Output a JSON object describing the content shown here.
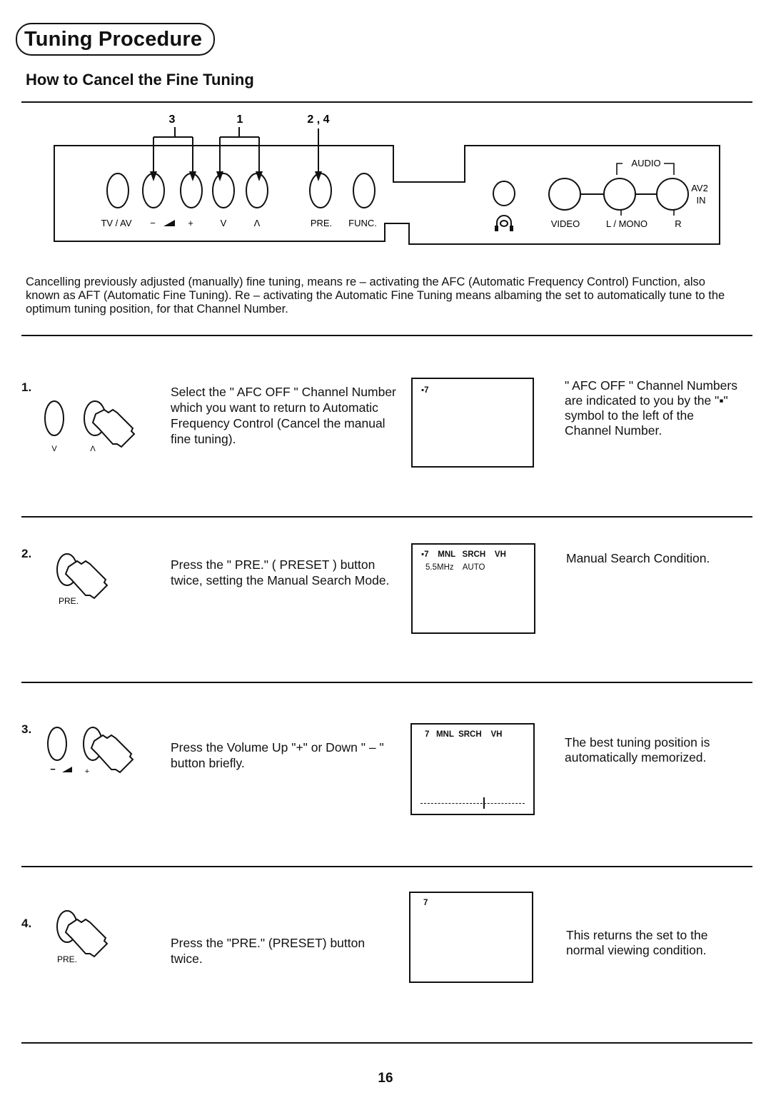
{
  "header": {
    "section_title": "Tuning Procedure",
    "subtitle": "How to Cancel the Fine Tuning"
  },
  "panel": {
    "callouts": [
      {
        "label": "3",
        "targets": [
          "volume-down",
          "volume-up"
        ]
      },
      {
        "label": "1",
        "targets": [
          "channel-down",
          "channel-up"
        ]
      },
      {
        "label": "2 , 4",
        "targets": [
          "preset"
        ]
      }
    ],
    "buttons": [
      {
        "id": "tv-av",
        "label": "TV / AV"
      },
      {
        "id": "volume-down",
        "label": "−"
      },
      {
        "id": "volume-up",
        "label": "+"
      },
      {
        "id": "channel-down",
        "label": "V"
      },
      {
        "id": "channel-up",
        "label": "Λ"
      },
      {
        "id": "preset",
        "label": "PRE."
      },
      {
        "id": "function",
        "label": "FUNC."
      }
    ],
    "volume_icon": "volume-wedge-icon",
    "headphone_icon": "headphone-jack-icon",
    "jacks": {
      "video": "VIDEO",
      "left_mono": "L / MONO",
      "right": "R",
      "audio_group": "AUDIO",
      "input_name_line1": "AV2",
      "input_name_line2": "IN"
    }
  },
  "intro": "Cancelling previously adjusted (manually) fine tuning, means re – activating the AFC (Automatic Frequency Control) Function, also known as AFT (Automatic Fine Tuning). Re – activating the Automatic Fine Tuning means albaming the set to automatically tune to the optimum tuning position, for that Channel Number.",
  "steps": [
    {
      "number": "1.",
      "button_labels": [
        "V",
        "Λ"
      ],
      "pressed_button": "Λ",
      "instruction": "Select the \" AFC OFF \" Channel Number which you want to return to Automatic Frequency Control (Cancel the manual fine tuning).",
      "screen": {
        "line1": "▪7",
        "line2": ""
      },
      "note": "\" AFC OFF \" Channel Numbers are indicated to you by the \"▪\" symbol to the left of the Channel Number."
    },
    {
      "number": "2.",
      "button_labels": [
        "PRE."
      ],
      "pressed_button": "PRE.",
      "instruction": "Press the \" PRE.\" ( PRESET ) button twice, setting the Manual Search Mode.",
      "screen": {
        "line1": "▪7    MNL   SRCH    VH",
        "line2": "5.5MHz    AUTO"
      },
      "note": "Manual Search Condition."
    },
    {
      "number": "3.",
      "button_labels": [
        "−",
        "+"
      ],
      "pressed_button": "+",
      "instruction": "Press the Volume Up \"+\"  or Down \" – \" button briefly.",
      "screen": {
        "line1": "7   MNL  SRCH    VH",
        "line2": "",
        "tuning_position": 0.6
      },
      "note": "The best tuning position is automatically memorized."
    },
    {
      "number": "4.",
      "button_labels": [
        "PRE."
      ],
      "pressed_button": "PRE.",
      "instruction": "Press the \"PRE.\" (PRESET) button twice.",
      "screen": {
        "line1": "7",
        "line2": ""
      },
      "note": "This returns the set to the normal viewing condition."
    }
  ],
  "footer": {
    "page_number": "16"
  }
}
